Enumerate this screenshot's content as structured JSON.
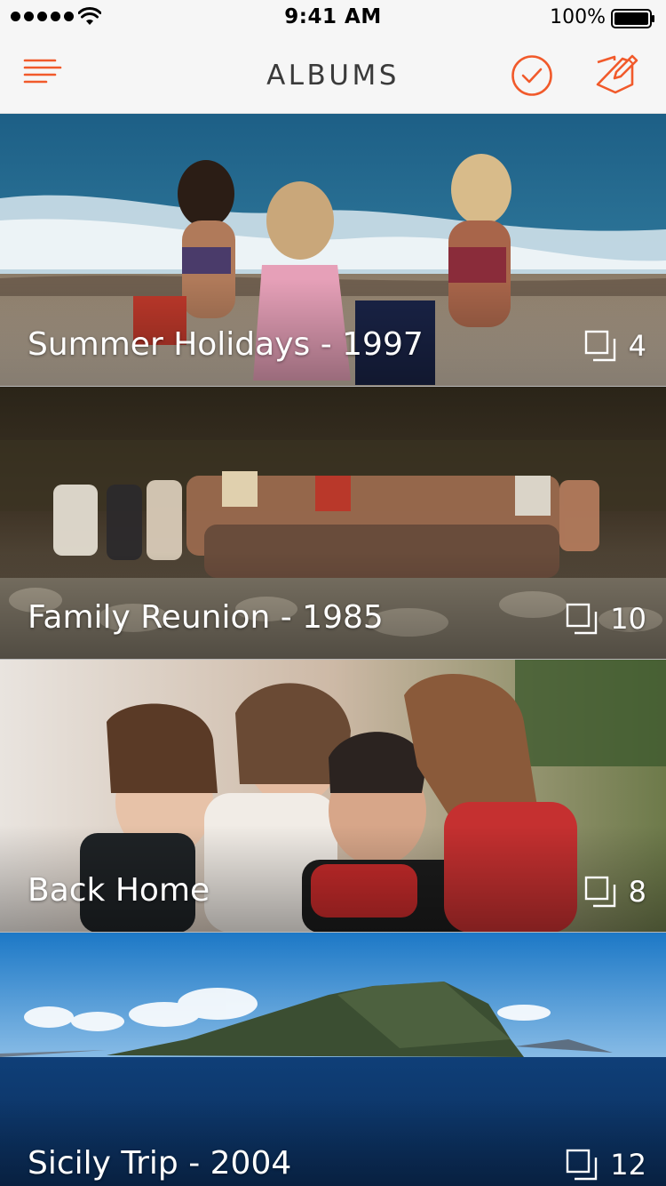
{
  "status_bar": {
    "time": "9:41 AM",
    "battery_percent": "100%",
    "signal_icon": "signal-dots-icon",
    "wifi_icon": "wifi-icon",
    "battery_icon": "battery-icon"
  },
  "nav": {
    "title": "ALBUMS",
    "menu_icon": "menu-icon",
    "check_icon": "check-circle-icon",
    "edit_icon": "edit-icon",
    "accent_color": "#f15a2b"
  },
  "albums": [
    {
      "title": "Summer Holidays - 1997",
      "count": "4",
      "icon": "photos-stack-icon"
    },
    {
      "title": "Family Reunion - 1985",
      "count": "10",
      "icon": "photos-stack-icon"
    },
    {
      "title": "Back Home",
      "count": "8",
      "icon": "photos-stack-icon"
    },
    {
      "title": "Sicily Trip - 2004",
      "count": "12",
      "icon": "photos-stack-icon"
    }
  ]
}
